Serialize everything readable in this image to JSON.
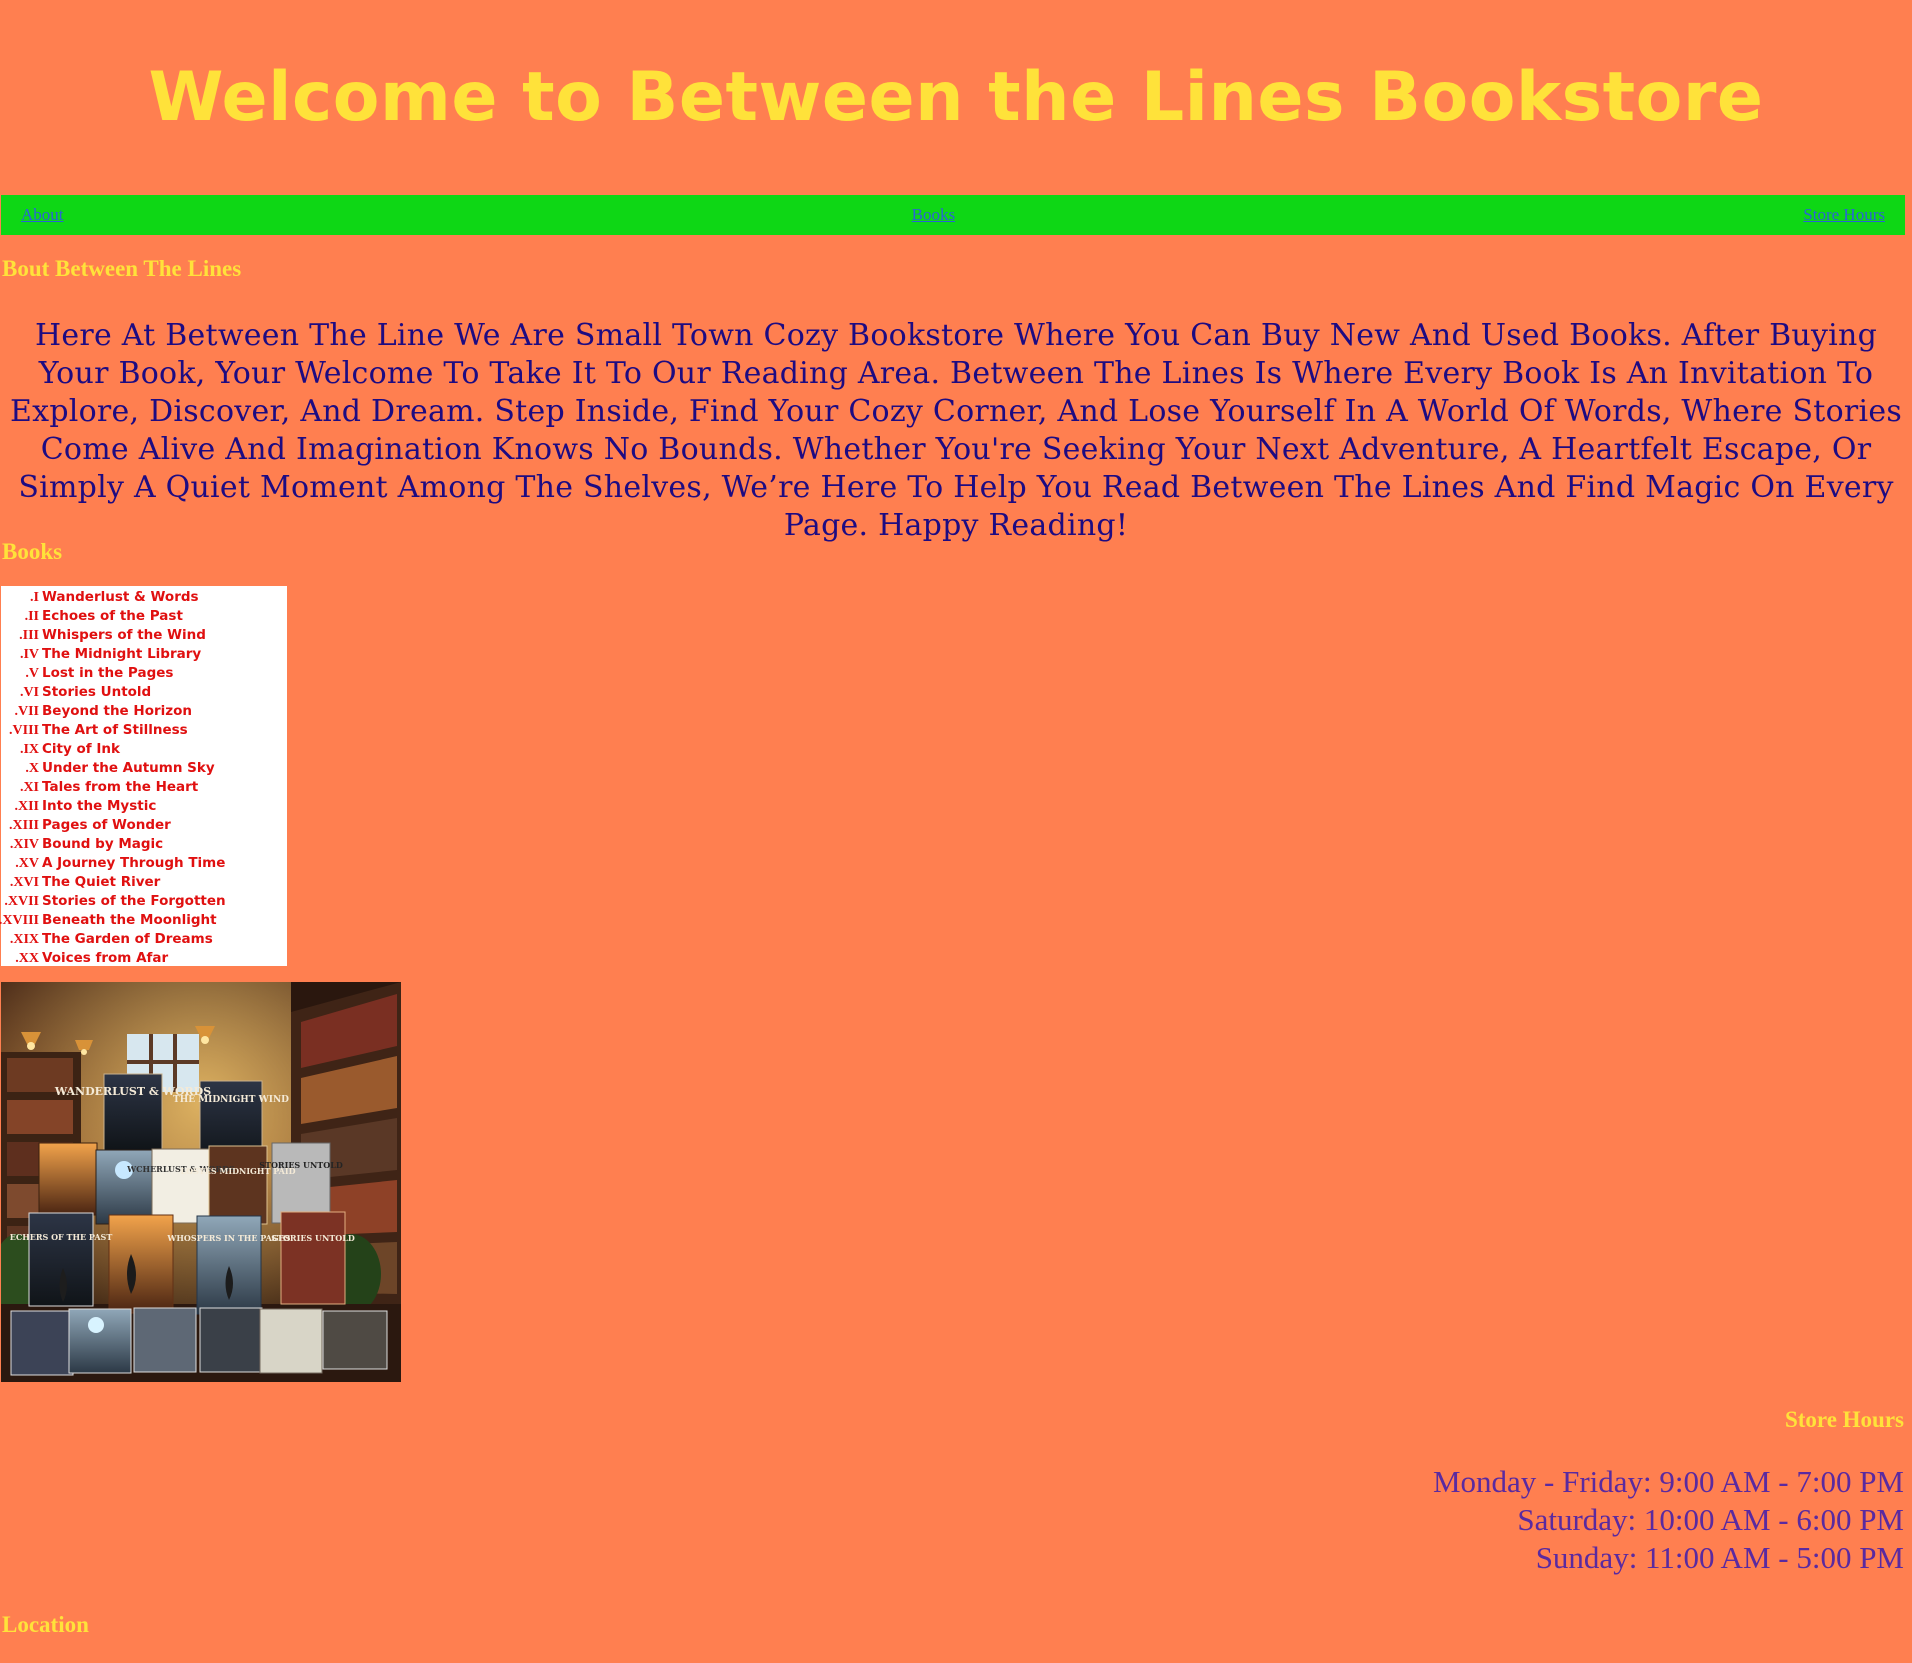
{
  "header": {
    "title": "Welcome to Between the Lines Bookstore"
  },
  "nav": {
    "links": [
      "About",
      "Books",
      "Store Hours"
    ]
  },
  "about": {
    "heading": "Bout Between The Lines",
    "text": "Here At Between The Line We Are Small Town Cozy Bookstore Where You Can Buy New And Used Books. After Buying Your Book, Your Welcome To Take It To Our Reading Area. Between The Lines Is Where Every Book Is An Invitation To Explore, Discover, And Dream. Step Inside, Find Your Cozy Corner, And Lose Yourself In A World Of Words, Where Stories Come Alive And Imagination Knows No Bounds. Whether You're Seeking Your Next Adventure, A Heartfelt Escape, Or Simply A Quiet Moment Among The Shelves, We’re Here To Help You Read Between The Lines And Find Magic On Every Page. Happy Reading!"
  },
  "books": {
    "heading": "Books",
    "items": [
      {
        "num": "I.",
        "title": "Wanderlust & Words"
      },
      {
        "num": "II.",
        "title": "Echoes of the Past"
      },
      {
        "num": "III.",
        "title": "Whispers of the Wind"
      },
      {
        "num": "IV.",
        "title": "The Midnight Library"
      },
      {
        "num": "V.",
        "title": "Lost in the Pages"
      },
      {
        "num": "VI.",
        "title": "Stories Untold"
      },
      {
        "num": "VII.",
        "title": "Beyond the Horizon"
      },
      {
        "num": "VIII.",
        "title": "The Art of Stillness"
      },
      {
        "num": "IX.",
        "title": "City of Ink"
      },
      {
        "num": "X.",
        "title": "Under the Autumn Sky"
      },
      {
        "num": "XI.",
        "title": "Tales from the Heart"
      },
      {
        "num": "XII.",
        "title": "Into the Mystic"
      },
      {
        "num": "XIII.",
        "title": "Pages of Wonder"
      },
      {
        "num": "XIV.",
        "title": "Bound by Magic"
      },
      {
        "num": "XV.",
        "title": "A Journey Through Time"
      },
      {
        "num": "XVI.",
        "title": "The Quiet River"
      },
      {
        "num": "XVII.",
        "title": "Stories of the Forgotten"
      },
      {
        "num": "XVIII.",
        "title": "Beneath the Moonlight"
      },
      {
        "num": "XIX.",
        "title": "The Garden of Dreams"
      },
      {
        "num": "XX.",
        "title": "Voices from Afar"
      }
    ],
    "image_cover_titles": [
      "WANDERLUST & WORDS",
      "THE MIDNIGHT WIND",
      "WCHERLUST & WORDS",
      "LOSTES MIDNIGHT PAID",
      "STORIES UNTOLD",
      "ECHERS OF THE PAST",
      "WHOSPERS IN THE PAGES",
      "STORIES UNTOLD"
    ]
  },
  "hours": {
    "heading": "Store Hours",
    "lines": [
      "Monday - Friday: 9:00 AM - 7:00 PM",
      "Saturday: 10:00 AM - 6:00 PM",
      "Sunday: 11:00 AM - 5:00 PM"
    ]
  },
  "location": {
    "heading": "Location"
  }
}
